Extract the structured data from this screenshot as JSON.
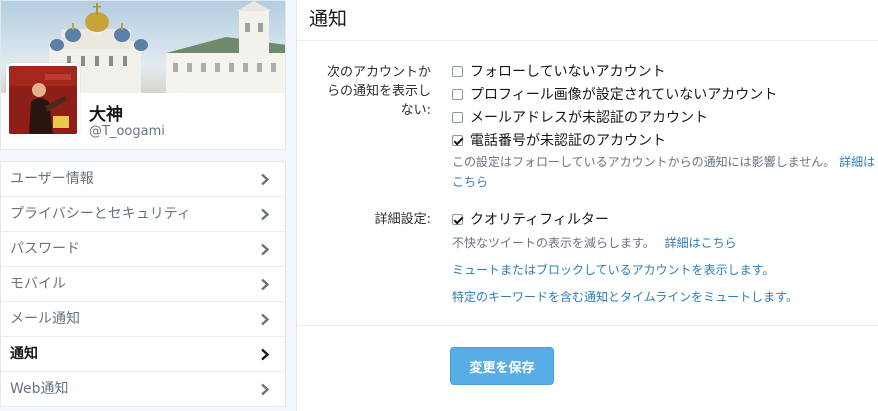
{
  "profile": {
    "display_name": "大神",
    "screen_name": "@T_oogami"
  },
  "nav": {
    "items": [
      {
        "label": "ユーザー情報",
        "active": false
      },
      {
        "label": "プライバシーとセキュリティ",
        "active": false
      },
      {
        "label": "パスワード",
        "active": false
      },
      {
        "label": "モバイル",
        "active": false
      },
      {
        "label": "メール通知",
        "active": false
      },
      {
        "label": "通知",
        "active": true
      },
      {
        "label": "Web通知",
        "active": false
      }
    ]
  },
  "panel": {
    "title": "通知",
    "mute_section": {
      "label_lines": [
        "次のアカウントか",
        "らの通知を表示し",
        "ない:"
      ],
      "options": [
        {
          "label": "フォローしていないアカウント",
          "checked": false
        },
        {
          "label": "プロフィール画像が設定されていないアカウント",
          "checked": false
        },
        {
          "label": "メールアドレスが未認証のアカウント",
          "checked": false
        },
        {
          "label": "電話番号が未認証のアカウント",
          "checked": true
        }
      ],
      "help_text": "この設定はフォローしているアカウントからの通知には影響しません。",
      "help_link_line1": "詳細は",
      "help_link_line2": "こちら"
    },
    "advanced_section": {
      "label": "詳細設定:",
      "quality_filter": {
        "label": "クオリティフィルター",
        "checked": true
      },
      "quality_help_text": "不快なツイートの表示を減らします。",
      "quality_help_link": "詳細はこちら",
      "muted_blocked": {
        "part1": "ミュートまたは",
        "link": "ブロック",
        "part2": "しているアカウントを表示します。"
      },
      "muted_words": "特定のキーワードを含む通知とタイムラインをミュートします。"
    },
    "save_label": "変更を保存"
  },
  "colors": {
    "link": "#2b7bb9",
    "save_button": "#56aee5",
    "text_muted": "#66757f"
  },
  "icons": {
    "nav_chevron": "chevron-right-icon",
    "checkbox": "checkbox-icon"
  }
}
